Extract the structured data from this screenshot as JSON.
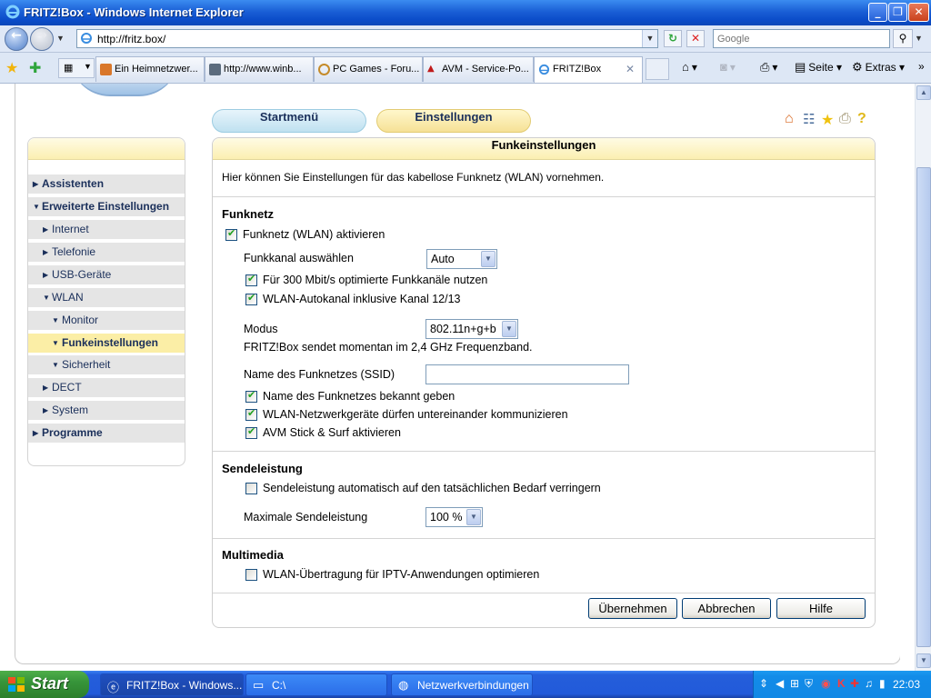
{
  "window": {
    "title": "FRITZ!Box - Windows Internet Explorer"
  },
  "address": {
    "url": "http://fritz.box/"
  },
  "search": {
    "placeholder": "Google"
  },
  "tabs": [
    {
      "label": "Ein Heimnetzwer..."
    },
    {
      "label": "http://www.winb..."
    },
    {
      "label": "PC Games - Foru..."
    },
    {
      "label": "AVM - Service-Po..."
    },
    {
      "label": "FRITZ!Box"
    }
  ],
  "commandbar": {
    "page": "Seite",
    "tools": "Extras"
  },
  "header": {
    "start_menu": "Startmenü",
    "settings": "Einstellungen"
  },
  "sidebar": {
    "items": [
      {
        "label": "Assistenten"
      },
      {
        "label": "Erweiterte Einstellungen"
      },
      {
        "label": "Internet"
      },
      {
        "label": "Telefonie"
      },
      {
        "label": "USB-Geräte"
      },
      {
        "label": "WLAN"
      },
      {
        "label": "Monitor"
      },
      {
        "label": "Funkeinstellungen"
      },
      {
        "label": "Sicherheit"
      },
      {
        "label": "DECT"
      },
      {
        "label": "System"
      },
      {
        "label": "Programme"
      }
    ]
  },
  "panel": {
    "title": "Funkeinstellungen",
    "intro": "Hier können Sie Einstellungen für das kabellose Funknetz (WLAN) vornehmen.",
    "funknetz": {
      "heading": "Funknetz",
      "activate": {
        "label": "Funknetz (WLAN) aktivieren",
        "checked": true
      },
      "channel_label": "Funkkanal auswählen",
      "channel_value": "Auto",
      "opt300": {
        "label": "Für 300 Mbit/s optimierte Funkkanäle nutzen",
        "checked": true
      },
      "autochannel": {
        "label": "WLAN-Autokanal inklusive Kanal 12/13",
        "checked": true
      },
      "mode_label": "Modus",
      "mode_value": "802.11n+g+b",
      "mode_info": "FRITZ!Box sendet momentan im 2,4 GHz Frequenzband.",
      "ssid_label": "Name des Funknetzes (SSID)",
      "ssid_value": "",
      "broadcast": {
        "label": "Name des Funknetzes bekannt geben",
        "checked": true
      },
      "intercom": {
        "label": "WLAN-Netzwerkgeräte dürfen untereinander kommunizieren",
        "checked": true
      },
      "stick": {
        "label": "AVM Stick & Surf aktivieren",
        "checked": true
      }
    },
    "power": {
      "heading": "Sendeleistung",
      "auto": {
        "label": "Sendeleistung automatisch auf den tatsächlichen Bedarf verringern",
        "checked": false
      },
      "max_label": "Maximale Sendeleistung",
      "max_value": "100 %"
    },
    "multimedia": {
      "heading": "Multimedia",
      "iptv": {
        "label": "WLAN-Übertragung für IPTV-Anwendungen optimieren",
        "checked": false
      }
    },
    "buttons": {
      "apply": "Übernehmen",
      "cancel": "Abbrechen",
      "help": "Hilfe"
    }
  },
  "taskbar": {
    "start": "Start",
    "items": [
      {
        "label": "FRITZ!Box - Windows..."
      },
      {
        "label": "C:\\"
      },
      {
        "label": "Netzwerkverbindungen"
      }
    ],
    "clock": "22:03"
  },
  "colors": {
    "header_yellow": "#fbefb1",
    "start_menu_blue": "#bfe1f0",
    "nav_gray": "#e5e5e5",
    "nav_active": "#fbeea6",
    "check_green": "#21a121"
  }
}
